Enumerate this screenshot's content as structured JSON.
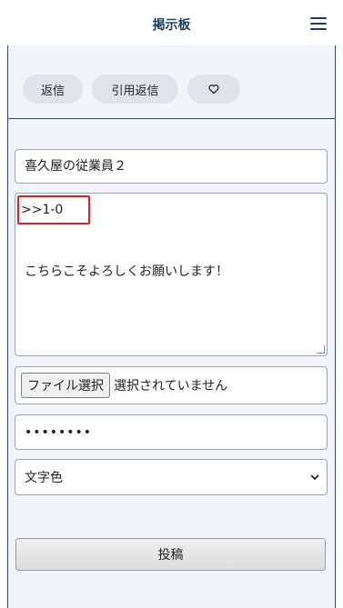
{
  "header": {
    "title": "掲示板",
    "menu_icon": "hamburger-menu-icon"
  },
  "actions": {
    "reply_label": "返信",
    "quote_reply_label": "引用返信",
    "like_icon": "heart-icon"
  },
  "form": {
    "name_value": "喜久屋の従業員２",
    "message": {
      "quote_ref": ">>1-0",
      "body": "こちらこそよろしくお願いします！"
    },
    "file": {
      "button_label": "ファイル選択",
      "status": "選択されていません"
    },
    "password_mask": "••••••••",
    "color_select": {
      "selected": "文字色"
    },
    "submit_label": "投稿"
  },
  "colors": {
    "header_text": "#1b3c5c",
    "panel_bg": "#f1f5fa",
    "highlight": "#e02020"
  }
}
